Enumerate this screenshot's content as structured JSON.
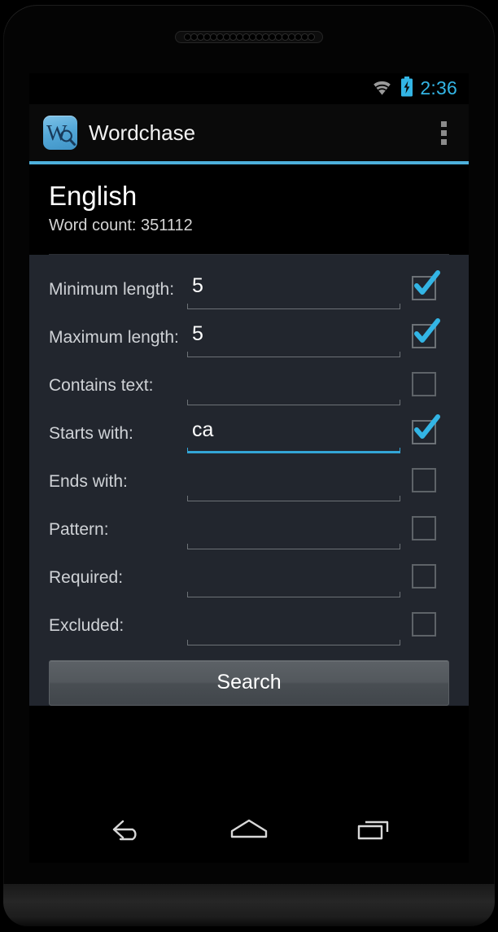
{
  "status_bar": {
    "time": "2:36",
    "wifi_icon": "wifi-icon",
    "battery_icon": "battery-charging-icon",
    "accent_color": "#33B5E5"
  },
  "action_bar": {
    "app_icon": "wordchase-app-icon",
    "title": "Wordchase",
    "overflow_icon": "overflow-menu-icon",
    "accent_color": "#4DB0DC"
  },
  "header": {
    "language": "English",
    "word_count_label": "Word count: 351112"
  },
  "form": {
    "rows": [
      {
        "label": "Minimum length:",
        "value": "5",
        "placeholder": "",
        "checked": true,
        "focused": false
      },
      {
        "label": "Maximum length:",
        "value": "5",
        "placeholder": "",
        "checked": true,
        "focused": false
      },
      {
        "label": "Contains text:",
        "value": "",
        "placeholder": "",
        "checked": false,
        "focused": false
      },
      {
        "label": "Starts with:",
        "value": "ca",
        "placeholder": "",
        "checked": true,
        "focused": true
      },
      {
        "label": "Ends with:",
        "value": "",
        "placeholder": "",
        "checked": false,
        "focused": false
      },
      {
        "label": "Pattern:",
        "value": "",
        "placeholder": "",
        "checked": false,
        "focused": false
      },
      {
        "label": "Required:",
        "value": "",
        "placeholder": "",
        "checked": false,
        "focused": false
      },
      {
        "label": "Excluded:",
        "value": "",
        "placeholder": "",
        "checked": false,
        "focused": false
      }
    ],
    "search_label": "Search"
  },
  "nav_bar": {
    "back_icon": "back-arrow-icon",
    "home_icon": "home-icon",
    "recents_icon": "recent-apps-icon"
  },
  "colors": {
    "screen_background": "#000000",
    "form_background": "#22262E",
    "accent": "#33B5E5",
    "checkbox_check": "#33B5E5"
  }
}
